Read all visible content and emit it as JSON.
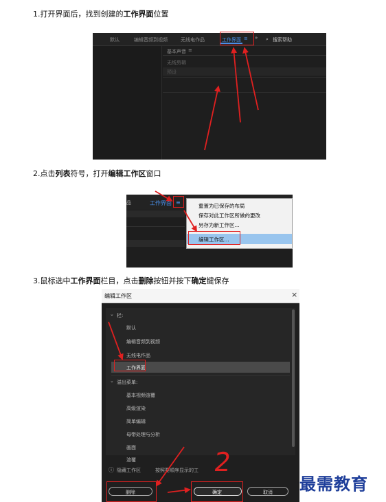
{
  "steps": [
    {
      "number": "1.",
      "pre": "打开界面后，找到创建的",
      "bold": "工作界面",
      "post": "位置"
    },
    {
      "number": "2.",
      "pre": "点击",
      "bold": "列表",
      "mid": "符号，打开",
      "bold2": "编辑工作区",
      "post": "窗口"
    },
    {
      "number": "3.",
      "pre": "鼠标选中",
      "bold": "工作界面",
      "mid": "栏目，点击",
      "bold2": "删除",
      "mid2": "按钮并按下",
      "bold3": "确定",
      "post": "键保存"
    }
  ],
  "shot1": {
    "tabs": [
      "默认",
      "编辑音频到视频",
      "无线电作品",
      "工作界面"
    ],
    "menu_icon": "≡",
    "overflow": "»",
    "search_placeholder": "搜索帮助",
    "panel_title": "基本声音",
    "panel_row1": "无线剪辑",
    "panel_row2": "预设"
  },
  "shot2": {
    "left_tab": "品",
    "tab": "工作界面",
    "menu_icon": "≡",
    "menu_items": [
      "重置为已保存的布局",
      "保存对此工作区所做的更改",
      "另存为新工作区...",
      "编辑工作区..."
    ]
  },
  "shot3": {
    "title": "编辑工作区",
    "close": "×",
    "group1": "栏:",
    "group1_items": [
      "默认",
      "编辑音频到视频",
      "无线电作品",
      "工作界面"
    ],
    "group2": "溢出菜单:",
    "group2_items": [
      "基本视频渲覆",
      "高级渲染",
      "简单编辑",
      "母带处理与分析",
      "画面",
      "渲覆"
    ],
    "info_icon": "ⓘ",
    "info_text": "隐藏工作区",
    "info_text2": "按照要顺序显示的工",
    "delete_label": "删除",
    "ok_label": "确定",
    "cancel_label": "取消",
    "annotation": "2"
  },
  "watermark": "最需教育"
}
